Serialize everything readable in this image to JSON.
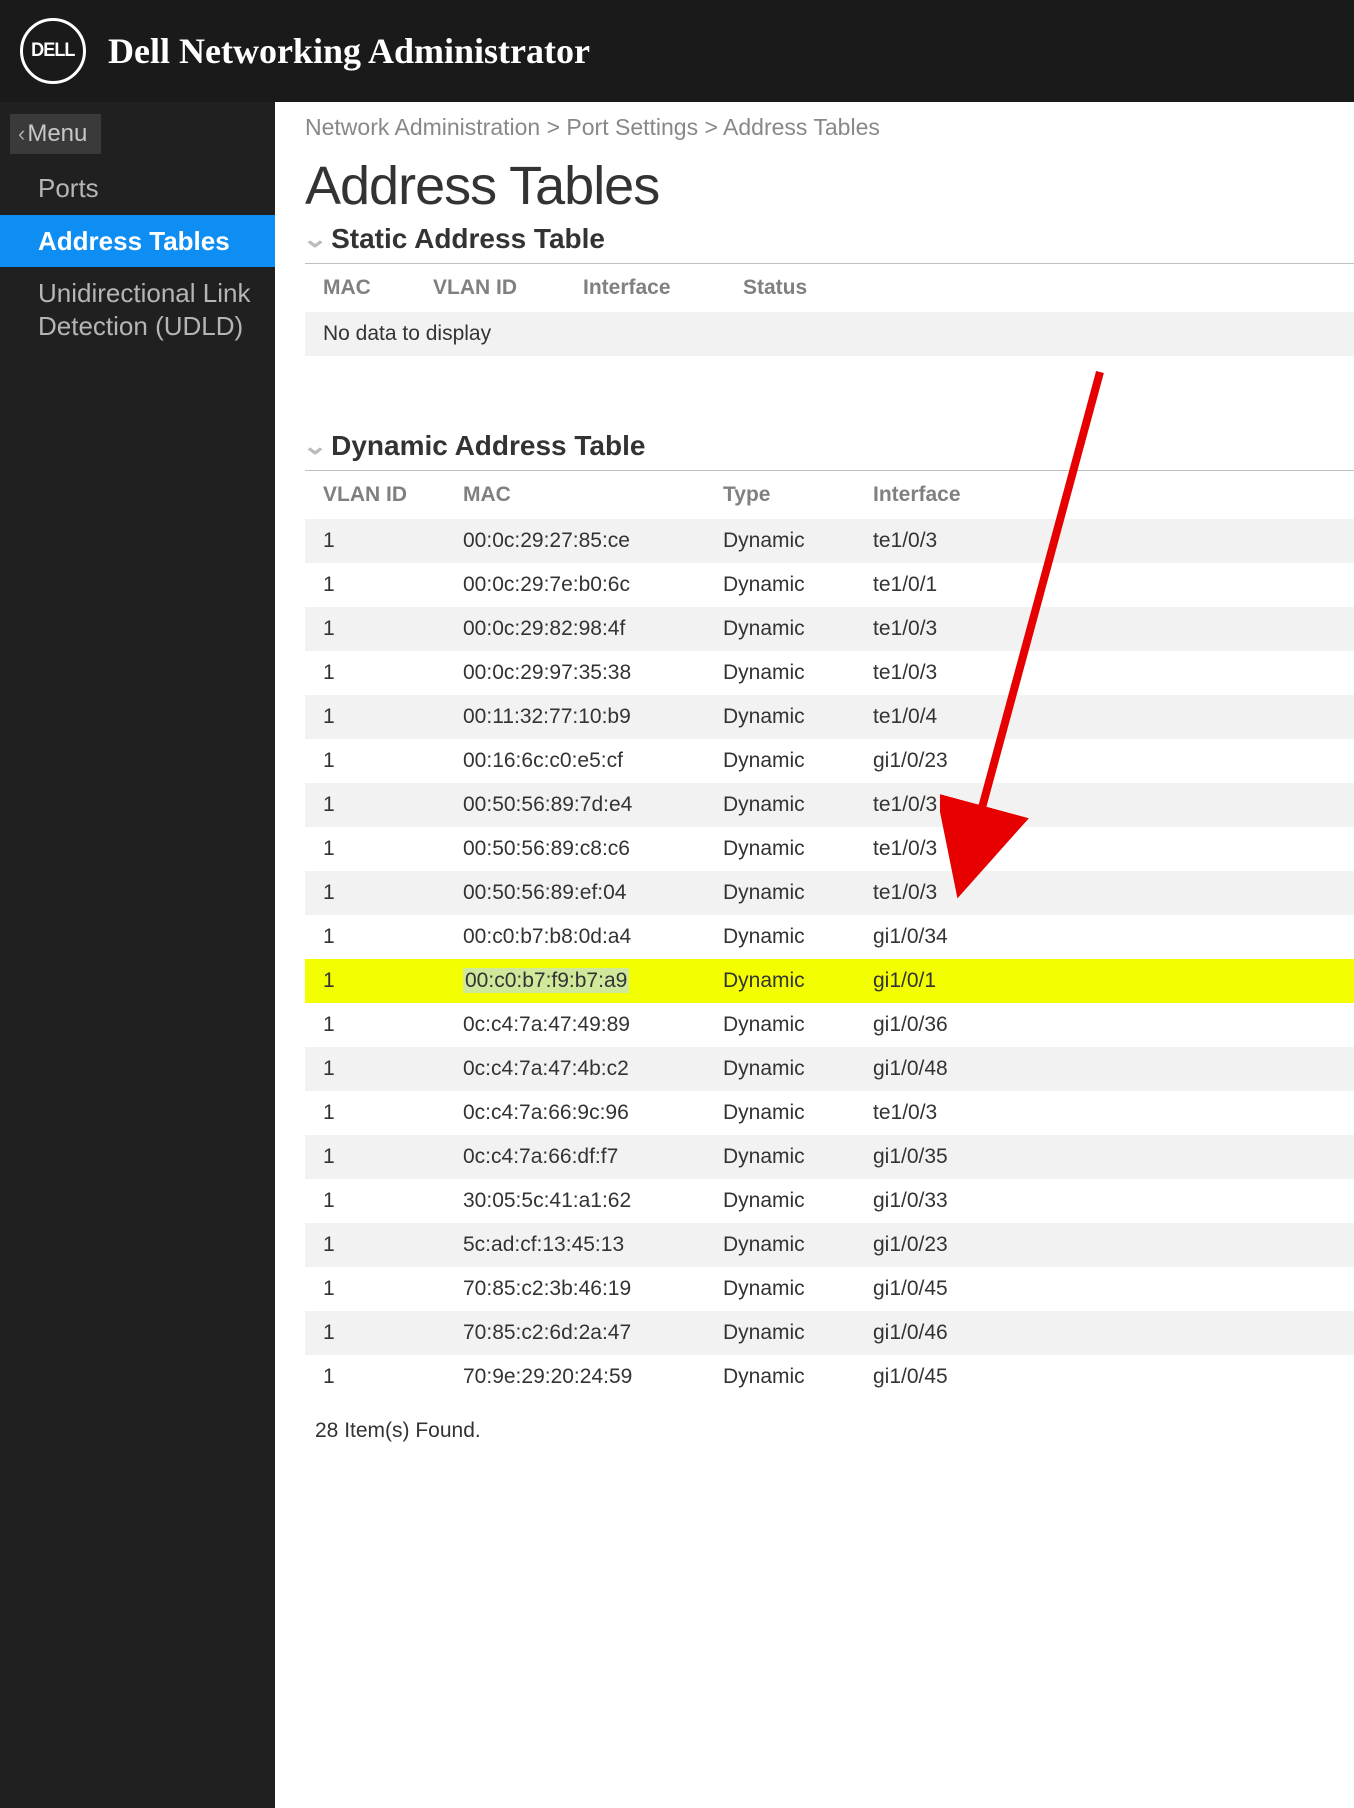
{
  "header": {
    "logo_text": "DELL",
    "title": "Dell Networking Administrator"
  },
  "sidebar": {
    "menu_label": "Menu",
    "items": [
      {
        "label": "Ports",
        "active": false
      },
      {
        "label": "Address Tables",
        "active": true
      },
      {
        "label": "Unidirectional Link Detection (UDLD)",
        "active": false
      }
    ]
  },
  "breadcrumb": "Network Administration > Port Settings > Address Tables",
  "page_title": "Address Tables",
  "static_table": {
    "title": "Static Address Table",
    "columns": [
      "MAC",
      "VLAN ID",
      "Interface",
      "Status"
    ],
    "nodata": "No data to display"
  },
  "dynamic_table": {
    "title": "Dynamic Address Table",
    "columns": [
      "VLAN ID",
      "MAC",
      "Type",
      "Interface"
    ],
    "rows": [
      {
        "vlan": "1",
        "mac": "00:0c:29:27:85:ce",
        "type": "Dynamic",
        "intf": "te1/0/3",
        "hl": false
      },
      {
        "vlan": "1",
        "mac": "00:0c:29:7e:b0:6c",
        "type": "Dynamic",
        "intf": "te1/0/1",
        "hl": false
      },
      {
        "vlan": "1",
        "mac": "00:0c:29:82:98:4f",
        "type": "Dynamic",
        "intf": "te1/0/3",
        "hl": false
      },
      {
        "vlan": "1",
        "mac": "00:0c:29:97:35:38",
        "type": "Dynamic",
        "intf": "te1/0/3",
        "hl": false
      },
      {
        "vlan": "1",
        "mac": "00:11:32:77:10:b9",
        "type": "Dynamic",
        "intf": "te1/0/4",
        "hl": false
      },
      {
        "vlan": "1",
        "mac": "00:16:6c:c0:e5:cf",
        "type": "Dynamic",
        "intf": "gi1/0/23",
        "hl": false
      },
      {
        "vlan": "1",
        "mac": "00:50:56:89:7d:e4",
        "type": "Dynamic",
        "intf": "te1/0/3",
        "hl": false
      },
      {
        "vlan": "1",
        "mac": "00:50:56:89:c8:c6",
        "type": "Dynamic",
        "intf": "te1/0/3",
        "hl": false
      },
      {
        "vlan": "1",
        "mac": "00:50:56:89:ef:04",
        "type": "Dynamic",
        "intf": "te1/0/3",
        "hl": false
      },
      {
        "vlan": "1",
        "mac": "00:c0:b7:b8:0d:a4",
        "type": "Dynamic",
        "intf": "gi1/0/34",
        "hl": false
      },
      {
        "vlan": "1",
        "mac": "00:c0:b7:f9:b7:a9",
        "type": "Dynamic",
        "intf": "gi1/0/1",
        "hl": true
      },
      {
        "vlan": "1",
        "mac": "0c:c4:7a:47:49:89",
        "type": "Dynamic",
        "intf": "gi1/0/36",
        "hl": false
      },
      {
        "vlan": "1",
        "mac": "0c:c4:7a:47:4b:c2",
        "type": "Dynamic",
        "intf": "gi1/0/48",
        "hl": false
      },
      {
        "vlan": "1",
        "mac": "0c:c4:7a:66:9c:96",
        "type": "Dynamic",
        "intf": "te1/0/3",
        "hl": false
      },
      {
        "vlan": "1",
        "mac": "0c:c4:7a:66:df:f7",
        "type": "Dynamic",
        "intf": "gi1/0/35",
        "hl": false
      },
      {
        "vlan": "1",
        "mac": "30:05:5c:41:a1:62",
        "type": "Dynamic",
        "intf": "gi1/0/33",
        "hl": false
      },
      {
        "vlan": "1",
        "mac": "5c:ad:cf:13:45:13",
        "type": "Dynamic",
        "intf": "gi1/0/23",
        "hl": false
      },
      {
        "vlan": "1",
        "mac": "70:85:c2:3b:46:19",
        "type": "Dynamic",
        "intf": "gi1/0/45",
        "hl": false
      },
      {
        "vlan": "1",
        "mac": "70:85:c2:6d:2a:47",
        "type": "Dynamic",
        "intf": "gi1/0/46",
        "hl": false
      },
      {
        "vlan": "1",
        "mac": "70:9e:29:20:24:59",
        "type": "Dynamic",
        "intf": "gi1/0/45",
        "hl": false
      }
    ]
  },
  "footer_count": "28 Item(s) Found."
}
